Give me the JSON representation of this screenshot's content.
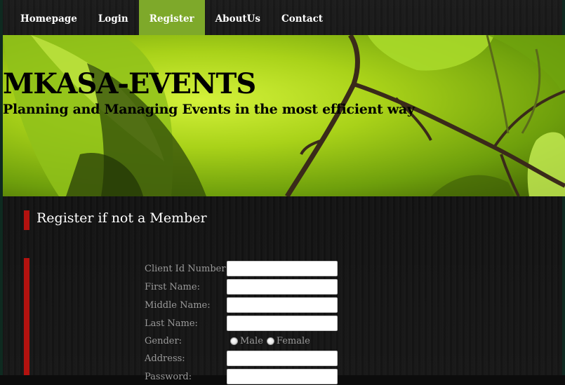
{
  "nav": {
    "items": [
      {
        "label": "Homepage",
        "active": false
      },
      {
        "label": "Login",
        "active": false
      },
      {
        "label": "Register",
        "active": true
      },
      {
        "label": "AboutUs",
        "active": false
      },
      {
        "label": "Contact",
        "active": false
      }
    ]
  },
  "banner": {
    "title": "MKASA-EVENTS",
    "tagline": "Planning and Managing Events in the most efficient way"
  },
  "register": {
    "heading": "Register if not a Member",
    "fields": {
      "client_id": {
        "label": "Client Id Number:",
        "value": ""
      },
      "first_name": {
        "label": "First Name:",
        "value": ""
      },
      "middle_name": {
        "label": "Middle Name:",
        "value": ""
      },
      "last_name": {
        "label": "Last Name:",
        "value": ""
      },
      "address": {
        "label": "Address:",
        "value": ""
      },
      "password": {
        "label": "Password:",
        "value": ""
      }
    },
    "gender": {
      "label": "Gender:",
      "options": [
        "Male",
        "Female"
      ]
    }
  },
  "colors": {
    "active_tab": "#7ea92a",
    "accent_bar": "#b3120f",
    "label_text": "#9a9a9a"
  }
}
